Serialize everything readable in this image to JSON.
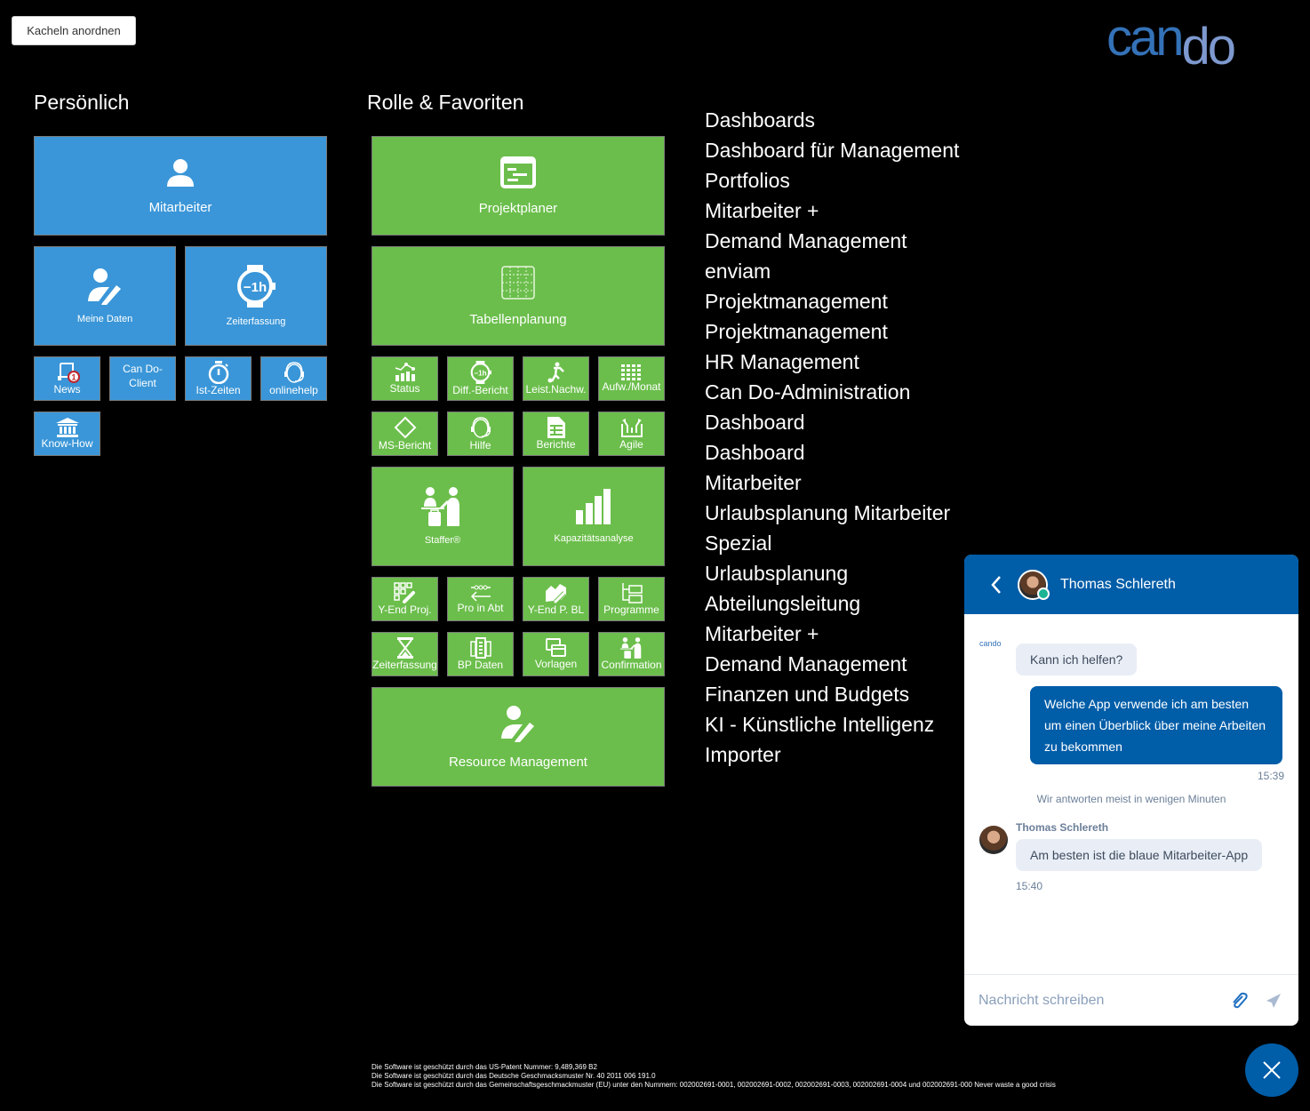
{
  "toolbar": {
    "arrange_label": "Kacheln anordnen"
  },
  "logo": {
    "part1": "can",
    "part2": "do"
  },
  "personal": {
    "title": "Persönlich",
    "tiles": [
      {
        "label": "Mitarbeiter",
        "icon": "user-icon"
      },
      {
        "label": "Meine Daten",
        "icon": "user-edit-icon"
      },
      {
        "label": "Zeiterfassung",
        "icon": "watch-minus-1h-icon"
      },
      {
        "label": "News",
        "icon": "news-badge-icon",
        "badge": "1"
      },
      {
        "label": "Can Do-Client",
        "label_line1": "Can Do-",
        "label_line2": "Client"
      },
      {
        "label": "Ist-Zeiten",
        "icon": "stopwatch-icon"
      },
      {
        "label": "onlinehelp",
        "icon": "headset-icon"
      },
      {
        "label": "Know-How",
        "icon": "institution-icon"
      }
    ]
  },
  "favorites": {
    "title": "Rolle & Favoriten",
    "tiles": [
      {
        "label": "Projektplaner",
        "icon": "gantt-icon"
      },
      {
        "label": "Tabellenplanung",
        "icon": "table-grid-icon"
      },
      {
        "label": "Status",
        "icon": "chart-status-icon"
      },
      {
        "label": "Diff.-Bericht",
        "icon": "watch-minus-1h-icon"
      },
      {
        "label": "Leist.Nachw.",
        "icon": "runner-icon"
      },
      {
        "label": "Aufw./Monat",
        "icon": "calendar-dots-icon"
      },
      {
        "label": "MS-Bericht",
        "icon": "diamond-icon"
      },
      {
        "label": "Hilfe",
        "icon": "headset-icon"
      },
      {
        "label": "Berichte",
        "icon": "report-icon"
      },
      {
        "label": "Agile",
        "icon": "agile-icon"
      },
      {
        "label": "Staffer®",
        "icon": "staffer-icon"
      },
      {
        "label": "Kapazitätsanalyse",
        "icon": "bar-chart-icon"
      },
      {
        "label": "Y-End Proj.",
        "icon": "grid-link-icon"
      },
      {
        "label": "Pro in Abt",
        "icon": "arrow-left-icon"
      },
      {
        "label": "Y-End P. BL",
        "icon": "area-link-icon"
      },
      {
        "label": "Programme",
        "icon": "folder-tree-icon"
      },
      {
        "label": "Zeiterfassung",
        "icon": "hourglass-icon"
      },
      {
        "label": "BP Daten",
        "icon": "building-icon"
      },
      {
        "label": "Vorlagen",
        "icon": "templates-icon"
      },
      {
        "label": "Confirmation",
        "icon": "staffer-icon"
      },
      {
        "label": "Resource Management",
        "icon": "user-edit-icon"
      }
    ]
  },
  "roles": [
    "Dashboards",
    "Dashboard für Management",
    "Portfolios",
    "Mitarbeiter +",
    "Demand Management",
    "enviam",
    "Projektmanagement",
    "Projektmanagement",
    "HR Management",
    "Can Do-Administration",
    "Dashboard",
    "Dashboard",
    "Mitarbeiter",
    "Urlaubsplanung Mitarbeiter",
    "Spezial",
    "Urlaubsplanung",
    "Abteilungsleitung",
    "Mitarbeiter +",
    "Demand Management",
    "Finanzen und Budgets",
    "KI - Künstliche Intelligenz",
    "Importer"
  ],
  "chat": {
    "contact_name": "Thomas Schlereth",
    "status": "online",
    "bot_logo": "cando",
    "messages": [
      {
        "from": "bot",
        "text": "Kann ich helfen?"
      },
      {
        "from": "user",
        "text": "Welche App verwende ich am besten um einen Überblick über meine Arbeiten zu bekommen",
        "time": "15:39"
      },
      {
        "from": "system",
        "text": "Wir antworten meist in wenigen Minuten"
      },
      {
        "from": "agent",
        "sender": "Thomas Schlereth",
        "text": "Am besten ist die blaue Mitarbeiter-App",
        "time": "15:40"
      }
    ],
    "input_placeholder": "Nachricht schreiben",
    "input_value": ""
  },
  "footer": [
    "Die Software ist geschützt durch das US-Patent Nummer: 9,489,369 B2",
    "Die Software ist geschützt durch das Deutsche Geschmacksmuster Nr. 40 2011 006 191.0",
    "Die Software ist geschützt durch das Gemeinschaftsgeschmackmuster (EU) unter den Nummern: 002002691-0001, 002002691-0002, 002002691-0003, 002002691-0004 und 002002691-000 Never waste a good crisis"
  ],
  "colors": {
    "tile_blue": "#3a96d8",
    "tile_green": "#6bbe4b",
    "chat_blue": "#005da8"
  }
}
